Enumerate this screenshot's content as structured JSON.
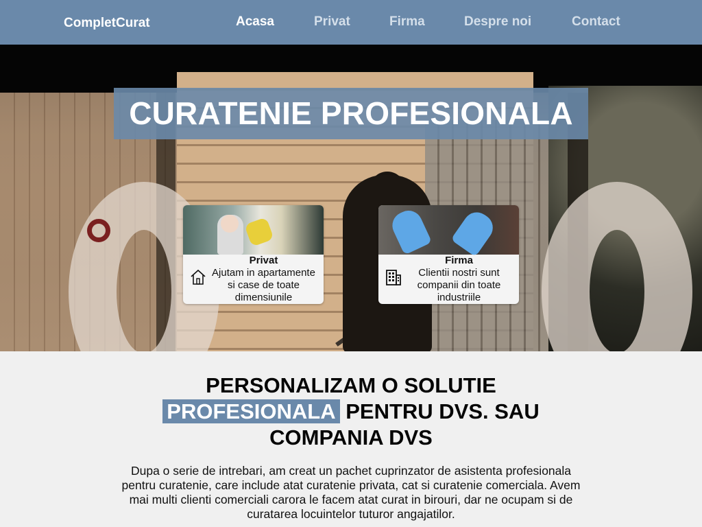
{
  "navbar": {
    "brand": "CompletCurat",
    "links": [
      {
        "label": "Acasa",
        "active": true
      },
      {
        "label": "Privat",
        "active": false
      },
      {
        "label": "Firma",
        "active": false
      },
      {
        "label": "Despre noi",
        "active": false
      },
      {
        "label": "Contact",
        "active": false
      }
    ]
  },
  "hero": {
    "title": "CURATENIE PROFESIONALA",
    "cards": [
      {
        "title": "Privat",
        "description": "Ajutam in apartamente si case de toate dimensiunile",
        "icon": "house-icon"
      },
      {
        "title": "Firma",
        "description": "Clientii nostri sunt companii din toate industriile",
        "icon": "building-icon"
      }
    ]
  },
  "main": {
    "headline_part1": "PERSONALIZAM O SOLUTIE",
    "headline_highlight": "PROFESIONALA",
    "headline_part2": "PENTRU DVS. SAU COMPANIA DVS",
    "intro": "Dupa o serie de intrebari, am creat un pachet cuprinzator de asistenta profesionala pentru curatenie, care include atat curatenie privata, cat si curatenie comerciala. Avem mai multi clienti comerciali carora le facem atat curat in birouri, dar ne ocupam si de curatarea locuintelor tuturor angajatilor."
  },
  "colors": {
    "accent": "#6a89aa",
    "background": "#f0f0f0"
  }
}
